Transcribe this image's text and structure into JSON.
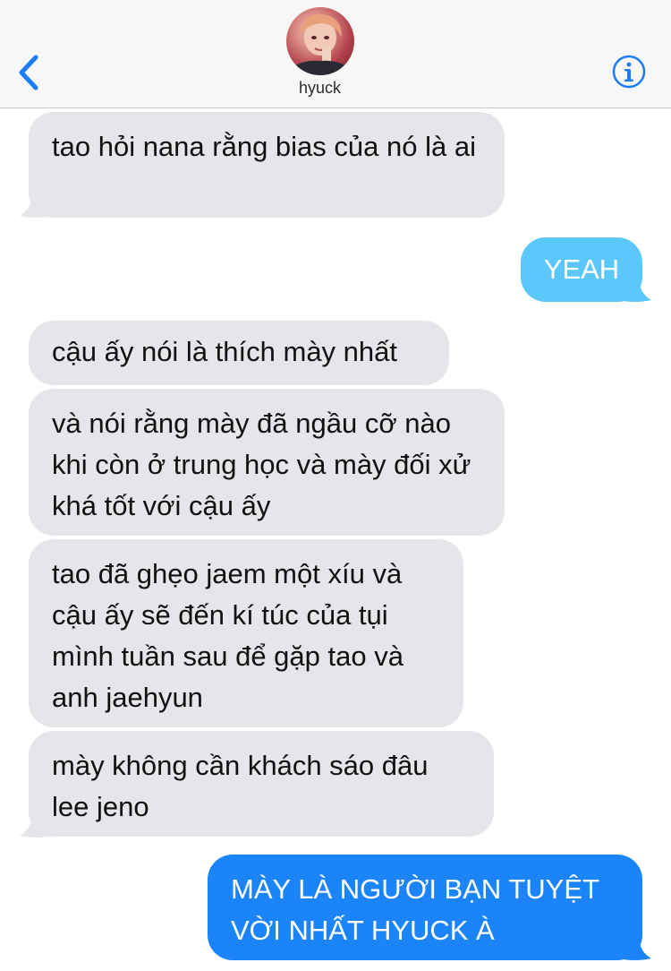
{
  "header": {
    "back_icon": "chevron-left-icon",
    "contact_name": "hyuck",
    "info_icon": "info-icon",
    "accent": "#1a7cf5"
  },
  "messages": [
    {
      "direction": "incoming",
      "text": "tao hỏi nana rằng bias của nó là ai"
    },
    {
      "direction": "outgoing",
      "text": "YEAH",
      "color": "#5ac8fa"
    },
    {
      "direction": "incoming",
      "text": "cậu ấy nói là thích mày nhất"
    },
    {
      "direction": "incoming",
      "text": "và nói rằng mày đã ngầu cỡ nào khi còn ở trung học và mày đối xử khá tốt với cậu ấy"
    },
    {
      "direction": "incoming",
      "text": "tao đã ghẹo jaem một xíu và cậu ấy sẽ đến kí túc của tụi mình tuần sau để gặp tao và anh jaehyun"
    },
    {
      "direction": "incoming",
      "text": "mày không cần khách sáo đâu lee jeno"
    },
    {
      "direction": "outgoing",
      "text": "MÀY LÀ NGƯỜI BẠN TUYỆT VỜI NHẤT HYUCK À",
      "color": "#1b84f8"
    }
  ],
  "colors": {
    "incoming_bubble": "#e6e5ea",
    "header_bg": "#f7f7f8"
  }
}
